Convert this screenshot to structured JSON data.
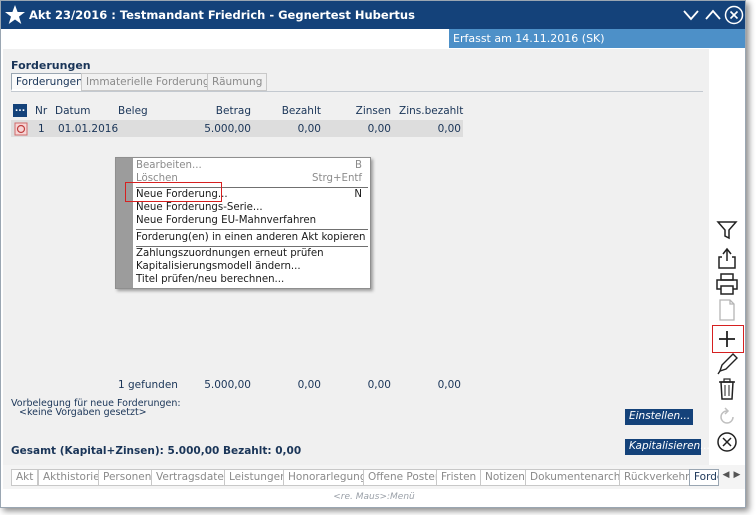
{
  "window": {
    "title": "Akt 23/2016 : Testmandant Friedrich - Gegnertest Hubertus",
    "captured": "Erfasst am 14.11.2016 (SK)"
  },
  "section": {
    "title": "Forderungen"
  },
  "tabs": [
    {
      "label": "Forderungen",
      "active": true
    },
    {
      "label": "Immaterielle Forderungen",
      "active": false
    },
    {
      "label": "Räumung",
      "active": false
    }
  ],
  "table": {
    "dots_label": "...",
    "headers": {
      "nr": "Nr",
      "datum": "Datum",
      "beleg": "Beleg",
      "betrag": "Betrag",
      "bezahlt": "Bezahlt",
      "zinsen": "Zinsen",
      "zins_bezahlt": "Zins.bezahlt"
    },
    "rows": [
      {
        "nr": "1",
        "datum": "01.01.2016",
        "beleg": "",
        "betrag": "5.000,00",
        "bezahlt": "0,00",
        "zinsen": "0,00",
        "zins_bezahlt": "0,00"
      }
    ],
    "totals": {
      "found": "1 gefunden",
      "betrag": "5.000,00",
      "bezahlt": "0,00",
      "zinsen": "0,00",
      "zins_bezahlt": "0,00"
    }
  },
  "context_menu": {
    "items": [
      {
        "label": "Bearbeiten...",
        "shortcut": "B",
        "disabled": true
      },
      {
        "label": "Löschen",
        "shortcut": "Strg+Entf",
        "disabled": true
      },
      {
        "label": "Neue Forderung...",
        "shortcut": "N",
        "disabled": false
      },
      {
        "label": "Neue Forderungs-Serie...",
        "shortcut": "",
        "disabled": false
      },
      {
        "label": "Neue Forderung EU-Mahnverfahren",
        "shortcut": "",
        "disabled": false
      },
      {
        "label": "Forderung(en) in einen anderen Akt kopieren",
        "shortcut": "",
        "disabled": false
      },
      {
        "label": "Zahlungszuordnungen erneut prüfen",
        "shortcut": "",
        "disabled": false
      },
      {
        "label": "Kapitalisierungsmodell ändern...",
        "shortcut": "",
        "disabled": false
      },
      {
        "label": "Titel prüfen/neu berechnen...",
        "shortcut": "",
        "disabled": false
      }
    ]
  },
  "footer": {
    "preset_label": "Vorbelegung für neue Forderungen:",
    "preset_value": "<keine Vorgaben gesetzt>",
    "total_text": "Gesamt (Kapital+Zinsen): 5.000,00  Bezahlt: 0,00",
    "einstellen_button": "Einstellen...",
    "kapitalisieren_button": "Kapitalisieren..."
  },
  "bottom_tabs": [
    "Akt",
    "Akthistorie",
    "Personen",
    "Vertragsdaten",
    "Leistungen",
    "Honorarlegung",
    "Offene Posten",
    "Fristen",
    "Notizen",
    "Dokumentenarchiv",
    "Rückverkehr",
    "Forde"
  ],
  "status_bar": "<re. Maus>:Menü",
  "right_toolbar": [
    "filter-icon",
    "share-icon",
    "print-icon",
    "document-icon",
    "add-icon",
    "edit-icon",
    "delete-icon",
    "refresh-icon",
    "close-circle-icon"
  ],
  "colors": {
    "titlebar": "#14427a",
    "strip": "#4d90c8",
    "accent_red": "#d62020"
  }
}
